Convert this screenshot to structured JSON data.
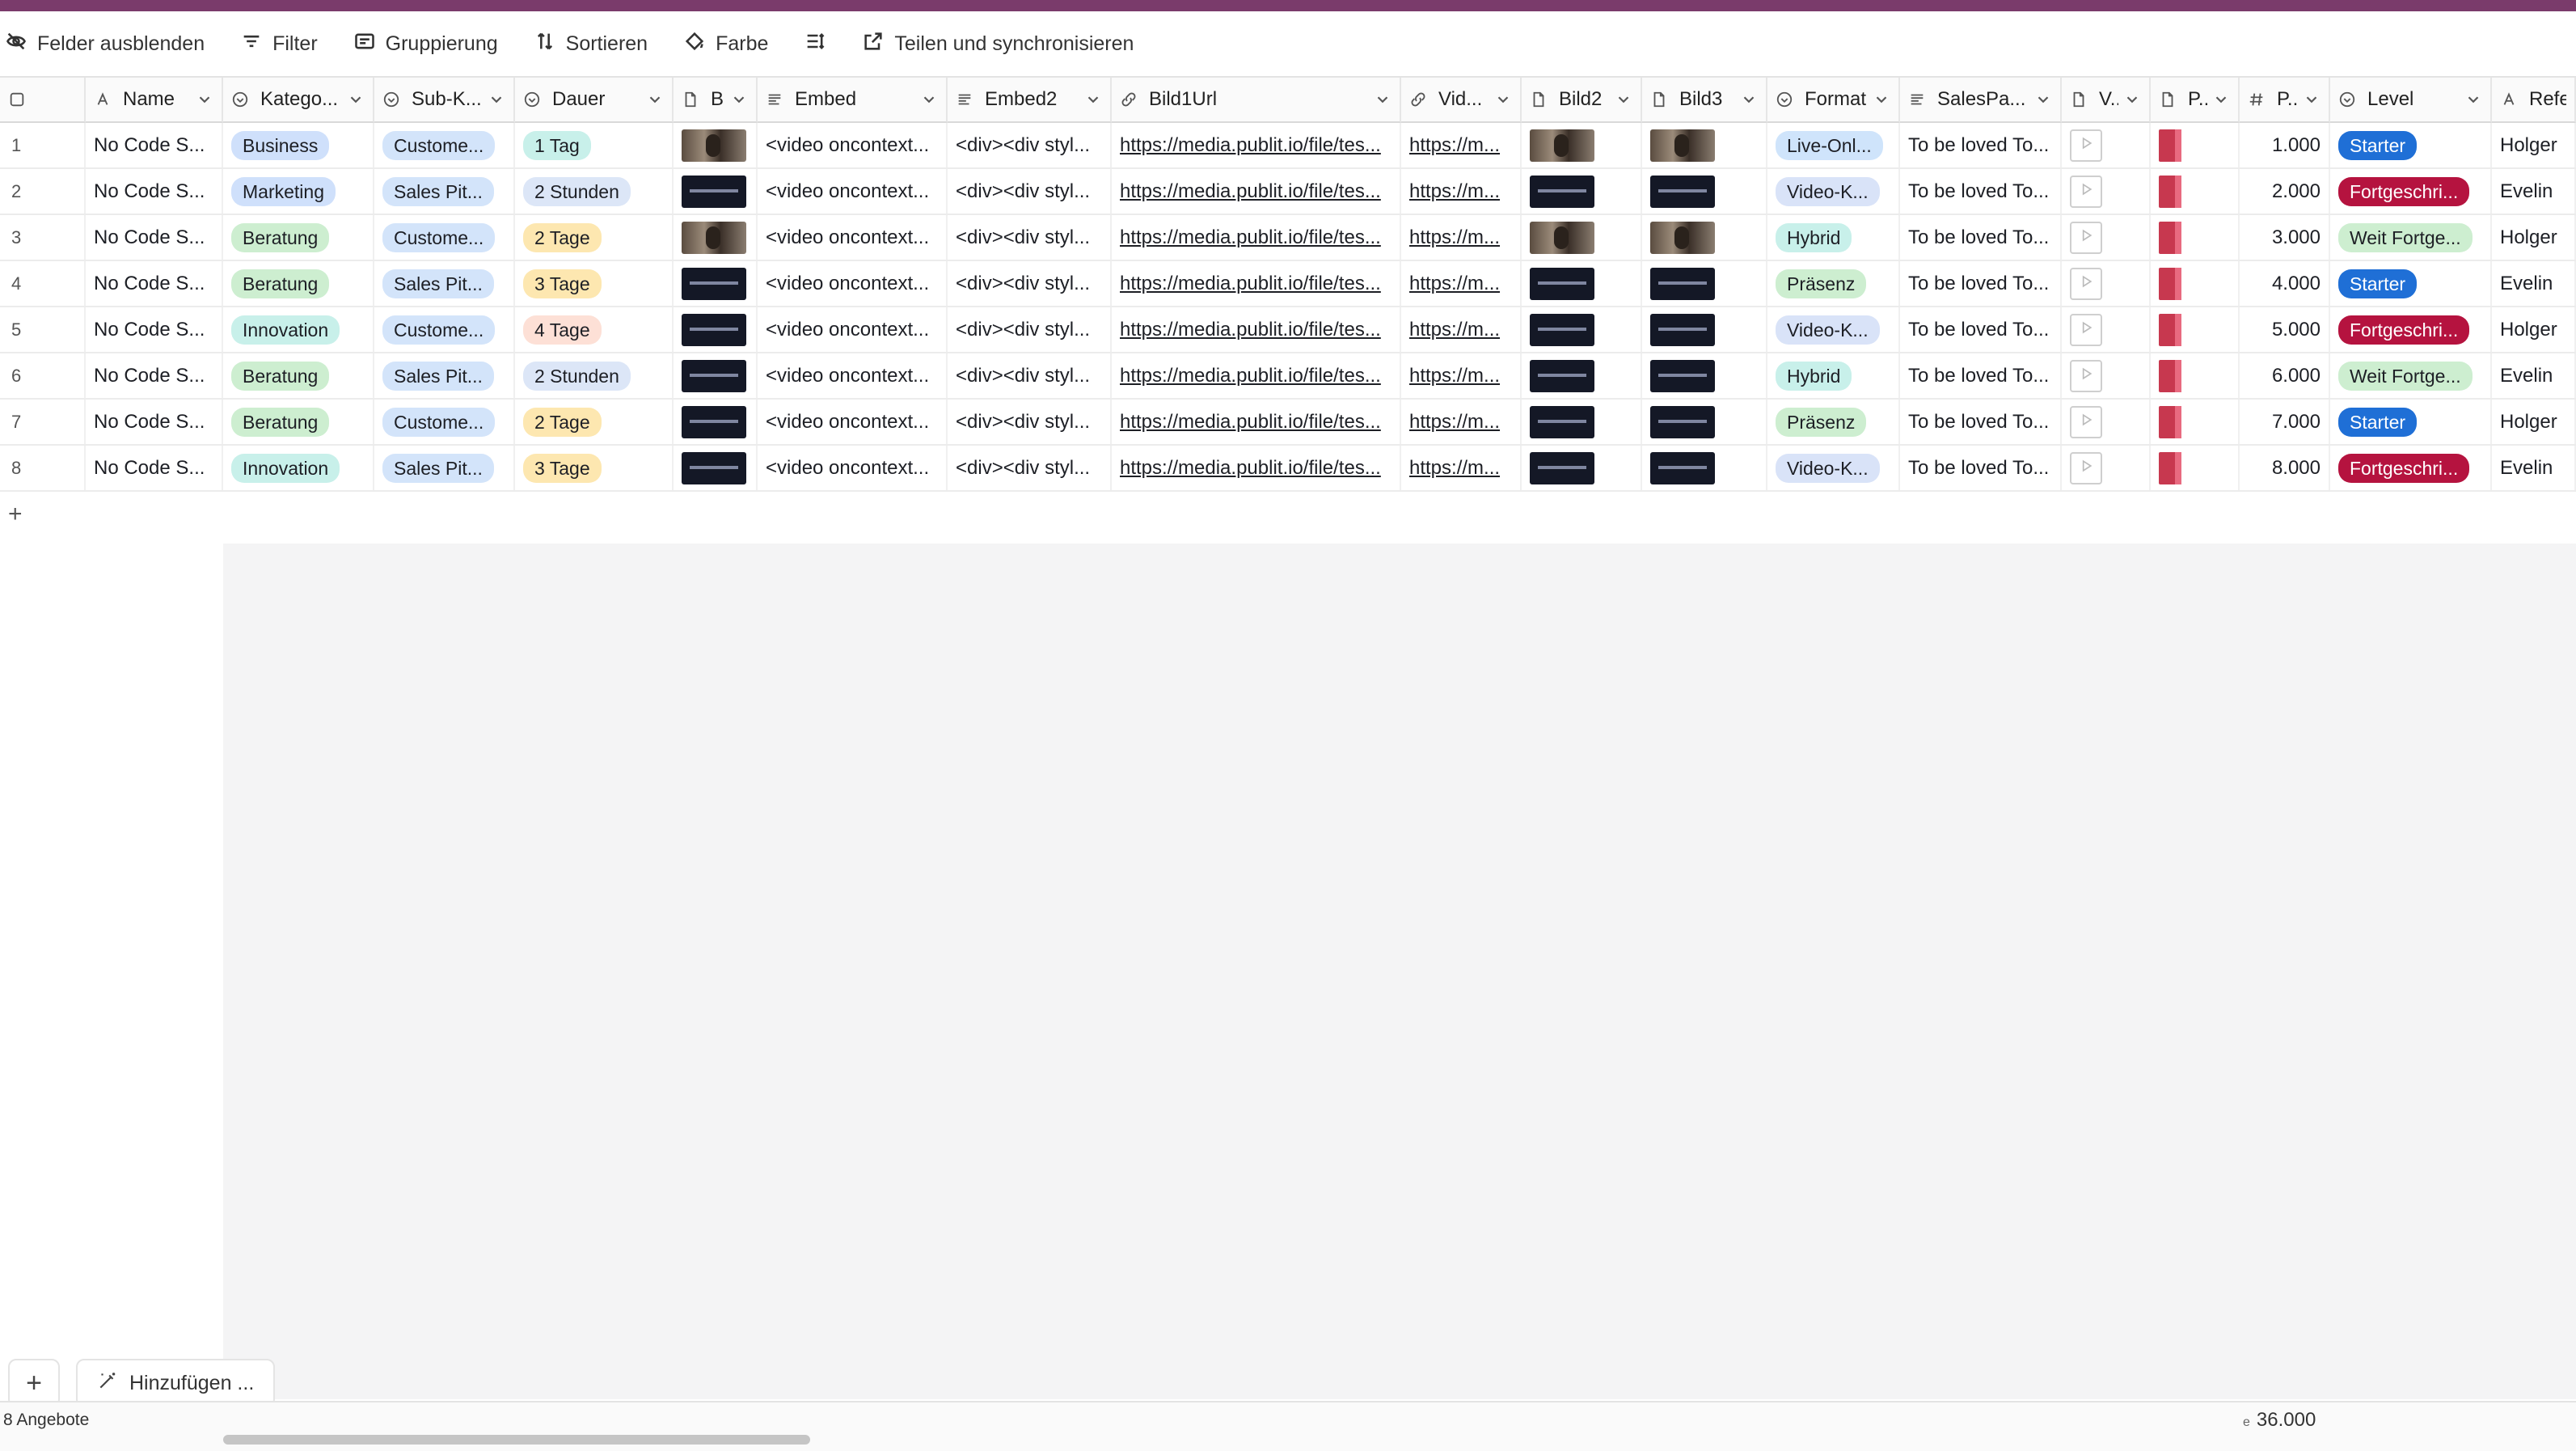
{
  "toolbar": [
    {
      "label": "Felder ausblenden",
      "icon": "eye-off-icon"
    },
    {
      "label": "Filter",
      "icon": "filter-icon"
    },
    {
      "label": "Gruppierung",
      "icon": "group-icon"
    },
    {
      "label": "Sortieren",
      "icon": "sort-icon"
    },
    {
      "label": "Farbe",
      "icon": "paint-icon"
    },
    {
      "label": "",
      "icon": "row-height-icon"
    },
    {
      "label": "Teilen und synchronisieren",
      "icon": "share-icon"
    }
  ],
  "columns": [
    {
      "key": "num",
      "label": "",
      "icon": "checkbox-icon"
    },
    {
      "key": "name",
      "label": "Name",
      "icon": "text-icon"
    },
    {
      "key": "kategorie",
      "label": "Katego...",
      "icon": "select-icon"
    },
    {
      "key": "subk",
      "label": "Sub-K...",
      "icon": "select-icon"
    },
    {
      "key": "dauer",
      "label": "Dauer",
      "icon": "select-icon"
    },
    {
      "key": "b",
      "label": "B.",
      "icon": "file-icon"
    },
    {
      "key": "embed",
      "label": "Embed",
      "icon": "longtext-icon"
    },
    {
      "key": "embed2",
      "label": "Embed2",
      "icon": "longtext-icon"
    },
    {
      "key": "bild1url",
      "label": "Bild1Url",
      "icon": "link-icon"
    },
    {
      "key": "vid",
      "label": "Vid...",
      "icon": "link-icon"
    },
    {
      "key": "bild2",
      "label": "Bild2",
      "icon": "file-icon"
    },
    {
      "key": "bild3",
      "label": "Bild3",
      "icon": "file-icon"
    },
    {
      "key": "format",
      "label": "Format",
      "icon": "select-icon"
    },
    {
      "key": "salespa",
      "label": "SalesPa...",
      "icon": "longtext-icon"
    },
    {
      "key": "v",
      "label": "V...",
      "icon": "file-icon"
    },
    {
      "key": "p",
      "label": "P..",
      "icon": "file-icon"
    },
    {
      "key": "pnum",
      "label": "P..",
      "icon": "number-icon"
    },
    {
      "key": "level",
      "label": "Level",
      "icon": "select-icon"
    },
    {
      "key": "refe",
      "label": "Refe",
      "icon": "text-icon"
    }
  ],
  "rows": [
    {
      "n": "1",
      "name": "No Code S...",
      "kategorie": "Business",
      "subk": "Custome...",
      "dauer": "1 Tag",
      "embed": "<video oncontext...",
      "embed2": "<div><div styl...",
      "bild1url": "https://media.publit.io/file/tes...",
      "vid": "https://m...",
      "format": "Live-Onl...",
      "salespa": "To be loved To...",
      "pnum": "1.000",
      "level": "Starter",
      "refe": "Holger",
      "thumb": "photo"
    },
    {
      "n": "2",
      "name": "No Code S...",
      "kategorie": "Marketing",
      "subk": "Sales Pit...",
      "dauer": "2 Stunden",
      "embed": "<video oncontext...",
      "embed2": "<div><div styl...",
      "bild1url": "https://media.publit.io/file/tes...",
      "vid": "https://m...",
      "format": "Video-K...",
      "salespa": "To be loved To...",
      "pnum": "2.000",
      "level": "Fortgeschri...",
      "refe": "Evelin",
      "thumb": "dark"
    },
    {
      "n": "3",
      "name": "No Code S...",
      "kategorie": "Beratung",
      "subk": "Custome...",
      "dauer": "2 Tage",
      "embed": "<video oncontext...",
      "embed2": "<div><div styl...",
      "bild1url": "https://media.publit.io/file/tes...",
      "vid": "https://m...",
      "format": "Hybrid",
      "salespa": "To be loved To...",
      "pnum": "3.000",
      "level": "Weit Fortge...",
      "refe": "Holger",
      "thumb": "photo"
    },
    {
      "n": "4",
      "name": "No Code S...",
      "kategorie": "Beratung",
      "subk": "Sales Pit...",
      "dauer": "3 Tage",
      "embed": "<video oncontext...",
      "embed2": "<div><div styl...",
      "bild1url": "https://media.publit.io/file/tes...",
      "vid": "https://m...",
      "format": "Präsenz",
      "salespa": "To be loved To...",
      "pnum": "4.000",
      "level": "Starter",
      "refe": "Evelin",
      "thumb": "dark"
    },
    {
      "n": "5",
      "name": "No Code S...",
      "kategorie": "Innovation",
      "subk": "Custome...",
      "dauer": "4 Tage",
      "embed": "<video oncontext...",
      "embed2": "<div><div styl...",
      "bild1url": "https://media.publit.io/file/tes...",
      "vid": "https://m...",
      "format": "Video-K...",
      "salespa": "To be loved To...",
      "pnum": "5.000",
      "level": "Fortgeschri...",
      "refe": "Holger",
      "thumb": "dark"
    },
    {
      "n": "6",
      "name": "No Code S...",
      "kategorie": "Beratung",
      "subk": "Sales Pit...",
      "dauer": "2 Stunden",
      "embed": "<video oncontext...",
      "embed2": "<div><div styl...",
      "bild1url": "https://media.publit.io/file/tes...",
      "vid": "https://m...",
      "format": "Hybrid",
      "salespa": "To be loved To...",
      "pnum": "6.000",
      "level": "Weit Fortge...",
      "refe": "Evelin",
      "thumb": "dark"
    },
    {
      "n": "7",
      "name": "No Code S...",
      "kategorie": "Beratung",
      "subk": "Custome...",
      "dauer": "2 Tage",
      "embed": "<video oncontext...",
      "embed2": "<div><div styl...",
      "bild1url": "https://media.publit.io/file/tes...",
      "vid": "https://m...",
      "format": "Präsenz",
      "salespa": "To be loved To...",
      "pnum": "7.000",
      "level": "Starter",
      "refe": "Holger",
      "thumb": "dark"
    },
    {
      "n": "8",
      "name": "No Code S...",
      "kategorie": "Innovation",
      "subk": "Sales Pit...",
      "dauer": "3 Tage",
      "embed": "<video oncontext...",
      "embed2": "<div><div styl...",
      "bild1url": "https://media.publit.io/file/tes...",
      "vid": "https://m...",
      "format": "Video-K...",
      "salespa": "To be loved To...",
      "pnum": "8.000",
      "level": "Fortgeschri...",
      "refe": "Evelin",
      "thumb": "dark"
    }
  ],
  "pill_colors": {
    "Business": {
      "bg": "#cfe0fb",
      "fg": "#1d1f25"
    },
    "Marketing": {
      "bg": "#cfe0fb",
      "fg": "#1d1f25"
    },
    "Beratung": {
      "bg": "#cdeed0",
      "fg": "#1d1f25"
    },
    "Innovation": {
      "bg": "#c8f0ea",
      "fg": "#1d1f25"
    },
    "Custome...": {
      "bg": "#d3e4fa",
      "fg": "#1d1f25"
    },
    "Sales Pit...": {
      "bg": "#d3e4fa",
      "fg": "#1d1f25"
    },
    "1 Tag": {
      "bg": "#c8f0ea",
      "fg": "#1d1f25"
    },
    "2 Stunden": {
      "bg": "#dce6f7",
      "fg": "#1d1f25"
    },
    "2 Tage": {
      "bg": "#fde7b0",
      "fg": "#1d1f25"
    },
    "3 Tage": {
      "bg": "#fde7b0",
      "fg": "#1d1f25"
    },
    "4 Tage": {
      "bg": "#fde0d6",
      "fg": "#1d1f25"
    },
    "Live-Onl...": {
      "bg": "#cfe4fb",
      "fg": "#1d1f25"
    },
    "Video-K...": {
      "bg": "#d9e3f8",
      "fg": "#1d1f25"
    },
    "Hybrid": {
      "bg": "#c8f0ea",
      "fg": "#1d1f25"
    },
    "Präsenz": {
      "bg": "#cdeed0",
      "fg": "#1d1f25"
    },
    "Starter": {
      "bg": "#1f6fd6",
      "fg": "#ffffff"
    },
    "Fortgeschri...": {
      "bg": "#b5133f",
      "fg": "#ffffff"
    },
    "Weit Fortge...": {
      "bg": "#cdeed0",
      "fg": "#1d1f25"
    }
  },
  "add_row_symbol": "+",
  "add_field_label": "Hinzufügen ...",
  "footer": {
    "count": "8 Angebote",
    "sum_prefix": "e",
    "sum": "36.000"
  }
}
